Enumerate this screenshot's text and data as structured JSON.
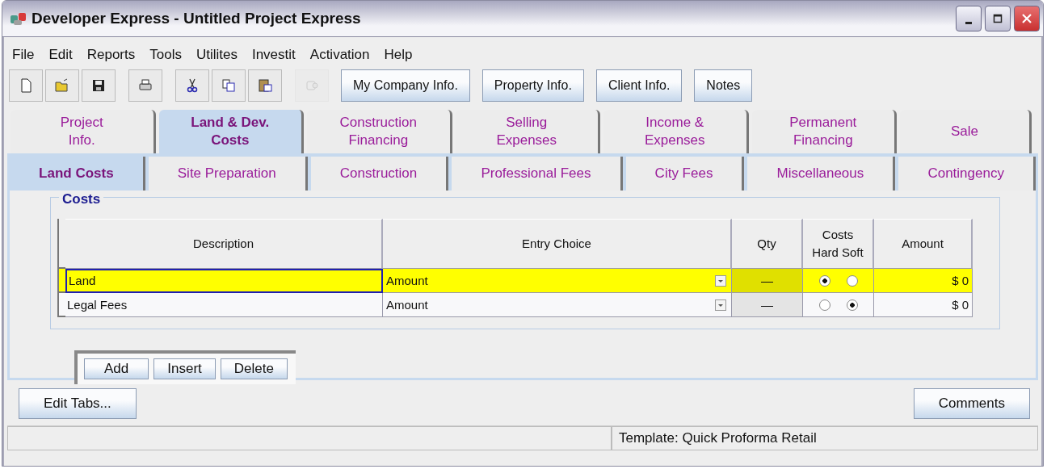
{
  "window": {
    "title": "Developer Express  - Untitled Project Express"
  },
  "menu": [
    "File",
    "Edit",
    "Reports",
    "Tools",
    "Utilites",
    "Investit",
    "Activation",
    "Help"
  ],
  "toolbar": {
    "icons": [
      {
        "kind": "new",
        "disabled": false
      },
      {
        "kind": "open",
        "disabled": false
      },
      {
        "kind": "save",
        "disabled": false
      },
      {
        "kind": "print",
        "disabled": false
      },
      {
        "kind": "cut",
        "disabled": false
      },
      {
        "kind": "copy",
        "disabled": false
      },
      {
        "kind": "paste",
        "disabled": false
      },
      {
        "kind": "chat",
        "disabled": true
      }
    ],
    "buttons": [
      "My Company Info.",
      "Property Info.",
      "Client Info.",
      "Notes"
    ]
  },
  "main_tabs": [
    {
      "label": "Project\nInfo.",
      "selected": false
    },
    {
      "label": "Land & Dev.\nCosts",
      "selected": true
    },
    {
      "label": "Construction\nFinancing",
      "selected": false
    },
    {
      "label": "Selling\nExpenses",
      "selected": false
    },
    {
      "label": "Income &\nExpenses",
      "selected": false
    },
    {
      "label": "Permanent\nFinancing",
      "selected": false
    },
    {
      "label": "Sale",
      "selected": false
    }
  ],
  "sub_tabs": [
    {
      "label": "Land Costs",
      "selected": true
    },
    {
      "label": "Site Preparation",
      "selected": false
    },
    {
      "label": "Construction",
      "selected": false
    },
    {
      "label": "Professional Fees",
      "selected": false
    },
    {
      "label": "City Fees",
      "selected": false
    },
    {
      "label": "Miscellaneous",
      "selected": false
    },
    {
      "label": "Contingency",
      "selected": false
    }
  ],
  "costs": {
    "title": "Costs",
    "columns": [
      "Description",
      "Entry Choice",
      "Qty",
      "Costs\nHard Soft",
      "Amount"
    ],
    "rows": [
      {
        "description": "Land",
        "entry_choice": "Amount",
        "qty": "—",
        "hard": true,
        "soft": false,
        "amount": "$ 0",
        "selected": true
      },
      {
        "description": "Legal Fees",
        "entry_choice": "Amount",
        "qty": "—",
        "hard": false,
        "soft": true,
        "amount": "$ 0",
        "selected": false
      }
    ],
    "buttons": [
      "Add",
      "Insert",
      "Delete"
    ]
  },
  "bottom_buttons": [
    "Edit Tabs...",
    "Comments"
  ],
  "status_bar": {
    "template": "Template: Quick Proforma Retail"
  }
}
